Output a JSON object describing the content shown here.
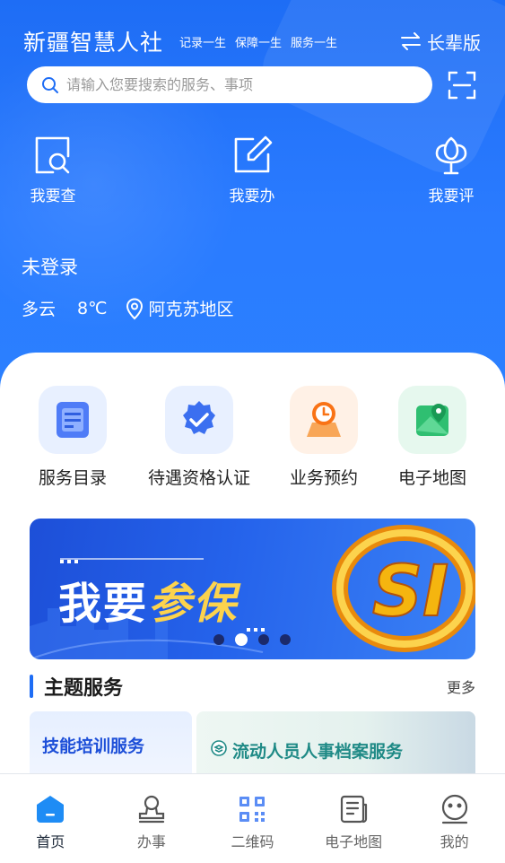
{
  "header": {
    "app_title": "新疆智慧人社",
    "slogans": [
      "记录一生",
      "保障一生",
      "服务一生"
    ],
    "elder_mode_label": "长辈版",
    "icons": {
      "elder_mode": "swap-arrows-icon",
      "scan": "scan-icon",
      "search": "search-icon"
    }
  },
  "search": {
    "placeholder": "请输入您要搜索的服务、事项"
  },
  "quick_actions": [
    {
      "label": "我要查",
      "icon": "search-doc-icon"
    },
    {
      "label": "我要办",
      "icon": "edit-icon"
    },
    {
      "label": "我要评",
      "icon": "flower-rate-icon"
    }
  ],
  "user": {
    "login_status": "未登录"
  },
  "weather": {
    "condition": "多云",
    "temperature": "8℃",
    "location": "阿克苏地区",
    "location_icon": "location-pin-icon"
  },
  "services": [
    {
      "label": "服务目录",
      "icon": "catalog-icon",
      "bg": "#e8f0ff"
    },
    {
      "label": "待遇资格认证",
      "icon": "verified-badge-icon",
      "bg": "#e8f0ff"
    },
    {
      "label": "业务预约",
      "icon": "appointment-clock-icon",
      "bg": "#fff1e6"
    },
    {
      "label": "电子地图",
      "icon": "map-pin-icon",
      "bg": "#e6f8ee"
    }
  ],
  "banner": {
    "text_white": "我要",
    "text_yellow": "参保",
    "logo_text": "SI",
    "dot_count": 4,
    "active_dot": 1
  },
  "theme_services": {
    "title": "主题服务",
    "more_label": "更多",
    "cards": [
      {
        "label": "技能培训服务"
      },
      {
        "label": "流动人员人事档案服务"
      }
    ]
  },
  "tabbar": [
    {
      "label": "首页",
      "icon": "home-icon",
      "active": true
    },
    {
      "label": "办事",
      "icon": "stamp-icon",
      "active": false
    },
    {
      "label": "二维码",
      "icon": "qrcode-icon",
      "active": false
    },
    {
      "label": "电子地图",
      "icon": "news-map-icon",
      "active": false
    },
    {
      "label": "我的",
      "icon": "smiley-profile-icon",
      "active": false
    }
  ],
  "colors": {
    "primary": "#1e6df5",
    "accent_yellow": "#fcd34d",
    "orange": "#f97316",
    "green": "#22c55e"
  }
}
